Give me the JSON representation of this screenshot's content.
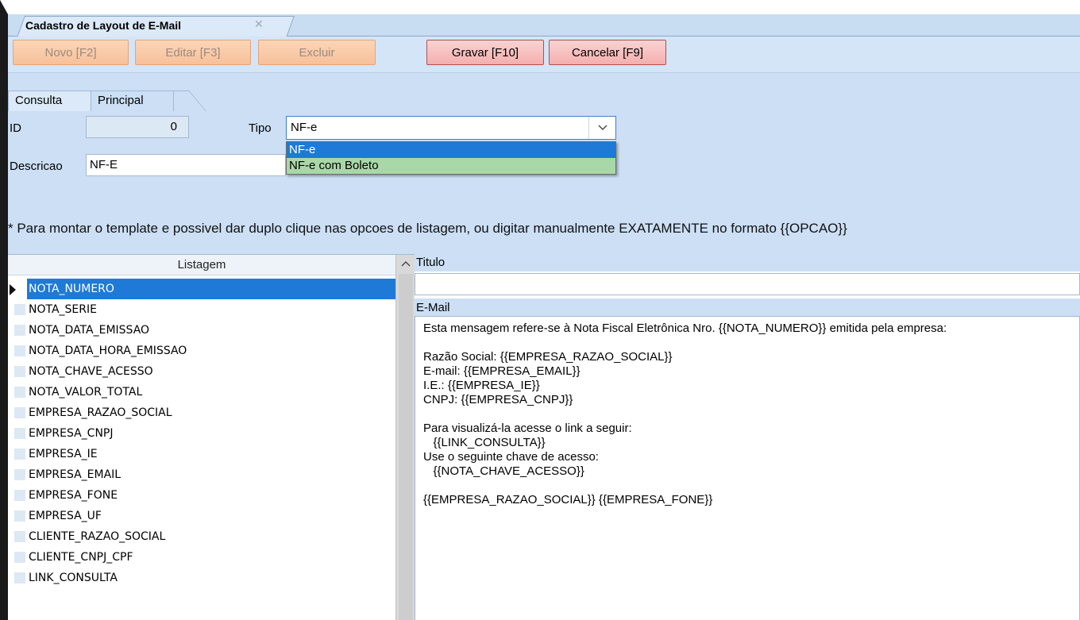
{
  "window": {
    "doc_tab_title": "Cadastro de Layout de E-Mail",
    "doc_tab_close": "✕"
  },
  "toolbar": {
    "novo": "Novo [F2]",
    "editar": "Editar [F3]",
    "excluir": "Excluir",
    "gravar": "Gravar [F10]",
    "cancelar": "Cancelar [F9]"
  },
  "tabs": {
    "consulta": "Consulta",
    "principal": "Principal"
  },
  "form": {
    "id_label": "ID",
    "id_value": "0",
    "tipo_label": "Tipo",
    "tipo_value": "NF-e",
    "descricao_label": "Descricao",
    "descricao_value": "NF-E",
    "tipo_options": [
      "NF-e",
      "NF-e com Boleto"
    ]
  },
  "hint": "* Para montar o template e possivel dar duplo clique nas opcoes de listagem, ou digitar manualmente EXATAMENTE no formato {{OPCAO}}",
  "listagem": {
    "header": "Listagem",
    "items": [
      "NOTA_NUMERO",
      "NOTA_SERIE",
      "NOTA_DATA_EMISSAO",
      "NOTA_DATA_HORA_EMISSAO",
      "NOTA_CHAVE_ACESSO",
      "NOTA_VALOR_TOTAL",
      "EMPRESA_RAZAO_SOCIAL",
      "EMPRESA_CNPJ",
      "EMPRESA_IE",
      "EMPRESA_EMAIL",
      "EMPRESA_FONE",
      "EMPRESA_UF",
      "CLIENTE_RAZAO_SOCIAL",
      "CLIENTE_CNPJ_CPF",
      "LINK_CONSULTA"
    ]
  },
  "titulo": {
    "label": "Titulo",
    "value": ""
  },
  "email": {
    "label": "E-Mail",
    "body": "Esta mensagem refere-se à Nota Fiscal Eletrônica Nro. {{NOTA_NUMERO}} emitida pela empresa:\n\nRazão Social: {{EMPRESA_RAZAO_SOCIAL}}\nE-mail: {{EMPRESA_EMAIL}}\nI.E.: {{EMPRESA_IE}}\nCNPJ: {{EMPRESA_CNPJ}}\n\nPara visualizá-la acesse o link a seguir:\n   {{LINK_CONSULTA}}\nUse o seguinte chave de acesso:\n   {{NOTA_CHAVE_ACESSO}}\n\n{{EMPRESA_RAZAO_SOCIAL}} {{EMPRESA_FONE}}"
  }
}
